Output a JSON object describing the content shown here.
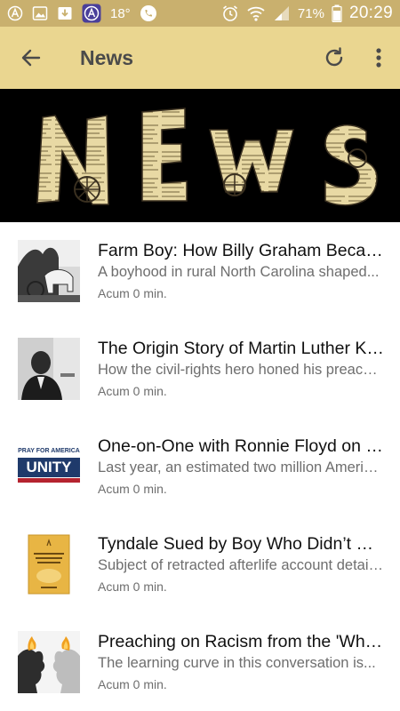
{
  "status_bar": {
    "temperature": "18°",
    "battery": "71%",
    "time": "20:29",
    "icons": [
      "a-circle-icon",
      "gallery-icon",
      "download-icon",
      "app-a-icon",
      "phone-icon",
      "alarm-icon",
      "wifi-icon",
      "signal-icon",
      "battery-icon"
    ]
  },
  "app_bar": {
    "title": "News",
    "back_icon": "arrow-left-icon",
    "refresh_icon": "refresh-icon",
    "menu_icon": "more-vert-icon"
  },
  "banner": {
    "letters": [
      "N",
      "E",
      "W",
      "S"
    ]
  },
  "colors": {
    "status_bar": "#c9b06e",
    "app_bar": "#ead690",
    "title_text": "#4a4a4a",
    "summary_text": "#6e6e6e"
  },
  "news_items": [
    {
      "title": "Farm Boy: How Billy Graham Became...",
      "summary": "A boyhood in rural North Carolina shaped...",
      "time": "Acum 0 min."
    },
    {
      "title": "The Origin Story of Martin Luther King...",
      "summary": "How the civil-rights hero honed his preaching...",
      "time": "Acum 0 min."
    },
    {
      "title": "One-on-One with Ronnie Floyd on the...",
      "summary": "Last year, an estimated two million Americans...",
      "time": "Acum 0 min.",
      "thumb_text_top": "PRAY FOR AMERICA",
      "thumb_text_main": "UNITY"
    },
    {
      "title": "Tyndale Sued by Boy Who Didn’t Come...",
      "summary": "Subject of retracted afterlife account details...",
      "time": "Acum 0 min."
    },
    {
      "title": "Preaching on Racism from the 'White...",
      "summary": "The learning curve in this conversation is...",
      "time": "Acum 0 min."
    }
  ]
}
